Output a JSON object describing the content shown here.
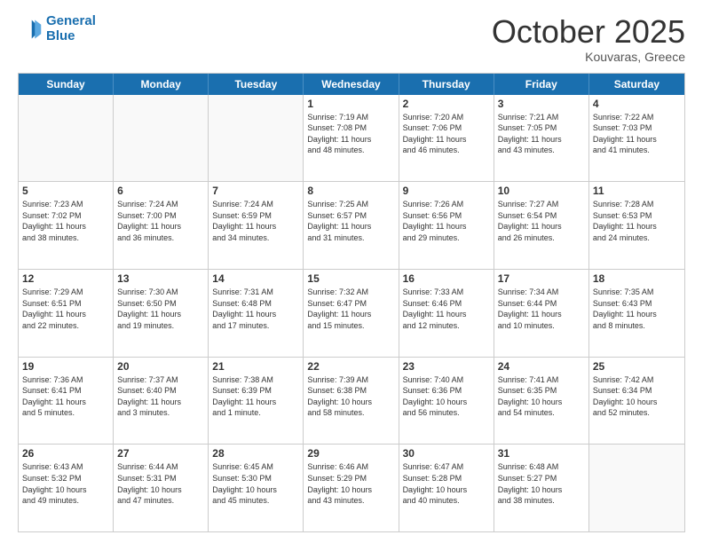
{
  "header": {
    "logo_line1": "General",
    "logo_line2": "Blue",
    "month_title": "October 2025",
    "location": "Kouvaras, Greece"
  },
  "days_of_week": [
    "Sunday",
    "Monday",
    "Tuesday",
    "Wednesday",
    "Thursday",
    "Friday",
    "Saturday"
  ],
  "weeks": [
    [
      {
        "day": "",
        "empty": true
      },
      {
        "day": "",
        "empty": true
      },
      {
        "day": "",
        "empty": true
      },
      {
        "day": "1",
        "line1": "Sunrise: 7:19 AM",
        "line2": "Sunset: 7:08 PM",
        "line3": "Daylight: 11 hours",
        "line4": "and 48 minutes."
      },
      {
        "day": "2",
        "line1": "Sunrise: 7:20 AM",
        "line2": "Sunset: 7:06 PM",
        "line3": "Daylight: 11 hours",
        "line4": "and 46 minutes."
      },
      {
        "day": "3",
        "line1": "Sunrise: 7:21 AM",
        "line2": "Sunset: 7:05 PM",
        "line3": "Daylight: 11 hours",
        "line4": "and 43 minutes."
      },
      {
        "day": "4",
        "line1": "Sunrise: 7:22 AM",
        "line2": "Sunset: 7:03 PM",
        "line3": "Daylight: 11 hours",
        "line4": "and 41 minutes."
      }
    ],
    [
      {
        "day": "5",
        "line1": "Sunrise: 7:23 AM",
        "line2": "Sunset: 7:02 PM",
        "line3": "Daylight: 11 hours",
        "line4": "and 38 minutes."
      },
      {
        "day": "6",
        "line1": "Sunrise: 7:24 AM",
        "line2": "Sunset: 7:00 PM",
        "line3": "Daylight: 11 hours",
        "line4": "and 36 minutes."
      },
      {
        "day": "7",
        "line1": "Sunrise: 7:24 AM",
        "line2": "Sunset: 6:59 PM",
        "line3": "Daylight: 11 hours",
        "line4": "and 34 minutes."
      },
      {
        "day": "8",
        "line1": "Sunrise: 7:25 AM",
        "line2": "Sunset: 6:57 PM",
        "line3": "Daylight: 11 hours",
        "line4": "and 31 minutes."
      },
      {
        "day": "9",
        "line1": "Sunrise: 7:26 AM",
        "line2": "Sunset: 6:56 PM",
        "line3": "Daylight: 11 hours",
        "line4": "and 29 minutes."
      },
      {
        "day": "10",
        "line1": "Sunrise: 7:27 AM",
        "line2": "Sunset: 6:54 PM",
        "line3": "Daylight: 11 hours",
        "line4": "and 26 minutes."
      },
      {
        "day": "11",
        "line1": "Sunrise: 7:28 AM",
        "line2": "Sunset: 6:53 PM",
        "line3": "Daylight: 11 hours",
        "line4": "and 24 minutes."
      }
    ],
    [
      {
        "day": "12",
        "line1": "Sunrise: 7:29 AM",
        "line2": "Sunset: 6:51 PM",
        "line3": "Daylight: 11 hours",
        "line4": "and 22 minutes."
      },
      {
        "day": "13",
        "line1": "Sunrise: 7:30 AM",
        "line2": "Sunset: 6:50 PM",
        "line3": "Daylight: 11 hours",
        "line4": "and 19 minutes."
      },
      {
        "day": "14",
        "line1": "Sunrise: 7:31 AM",
        "line2": "Sunset: 6:48 PM",
        "line3": "Daylight: 11 hours",
        "line4": "and 17 minutes."
      },
      {
        "day": "15",
        "line1": "Sunrise: 7:32 AM",
        "line2": "Sunset: 6:47 PM",
        "line3": "Daylight: 11 hours",
        "line4": "and 15 minutes."
      },
      {
        "day": "16",
        "line1": "Sunrise: 7:33 AM",
        "line2": "Sunset: 6:46 PM",
        "line3": "Daylight: 11 hours",
        "line4": "and 12 minutes."
      },
      {
        "day": "17",
        "line1": "Sunrise: 7:34 AM",
        "line2": "Sunset: 6:44 PM",
        "line3": "Daylight: 11 hours",
        "line4": "and 10 minutes."
      },
      {
        "day": "18",
        "line1": "Sunrise: 7:35 AM",
        "line2": "Sunset: 6:43 PM",
        "line3": "Daylight: 11 hours",
        "line4": "and 8 minutes."
      }
    ],
    [
      {
        "day": "19",
        "line1": "Sunrise: 7:36 AM",
        "line2": "Sunset: 6:41 PM",
        "line3": "Daylight: 11 hours",
        "line4": "and 5 minutes."
      },
      {
        "day": "20",
        "line1": "Sunrise: 7:37 AM",
        "line2": "Sunset: 6:40 PM",
        "line3": "Daylight: 11 hours",
        "line4": "and 3 minutes."
      },
      {
        "day": "21",
        "line1": "Sunrise: 7:38 AM",
        "line2": "Sunset: 6:39 PM",
        "line3": "Daylight: 11 hours",
        "line4": "and 1 minute."
      },
      {
        "day": "22",
        "line1": "Sunrise: 7:39 AM",
        "line2": "Sunset: 6:38 PM",
        "line3": "Daylight: 10 hours",
        "line4": "and 58 minutes."
      },
      {
        "day": "23",
        "line1": "Sunrise: 7:40 AM",
        "line2": "Sunset: 6:36 PM",
        "line3": "Daylight: 10 hours",
        "line4": "and 56 minutes."
      },
      {
        "day": "24",
        "line1": "Sunrise: 7:41 AM",
        "line2": "Sunset: 6:35 PM",
        "line3": "Daylight: 10 hours",
        "line4": "and 54 minutes."
      },
      {
        "day": "25",
        "line1": "Sunrise: 7:42 AM",
        "line2": "Sunset: 6:34 PM",
        "line3": "Daylight: 10 hours",
        "line4": "and 52 minutes."
      }
    ],
    [
      {
        "day": "26",
        "line1": "Sunrise: 6:43 AM",
        "line2": "Sunset: 5:32 PM",
        "line3": "Daylight: 10 hours",
        "line4": "and 49 minutes."
      },
      {
        "day": "27",
        "line1": "Sunrise: 6:44 AM",
        "line2": "Sunset: 5:31 PM",
        "line3": "Daylight: 10 hours",
        "line4": "and 47 minutes."
      },
      {
        "day": "28",
        "line1": "Sunrise: 6:45 AM",
        "line2": "Sunset: 5:30 PM",
        "line3": "Daylight: 10 hours",
        "line4": "and 45 minutes."
      },
      {
        "day": "29",
        "line1": "Sunrise: 6:46 AM",
        "line2": "Sunset: 5:29 PM",
        "line3": "Daylight: 10 hours",
        "line4": "and 43 minutes."
      },
      {
        "day": "30",
        "line1": "Sunrise: 6:47 AM",
        "line2": "Sunset: 5:28 PM",
        "line3": "Daylight: 10 hours",
        "line4": "and 40 minutes."
      },
      {
        "day": "31",
        "line1": "Sunrise: 6:48 AM",
        "line2": "Sunset: 5:27 PM",
        "line3": "Daylight: 10 hours",
        "line4": "and 38 minutes."
      },
      {
        "day": "",
        "empty": true
      }
    ]
  ]
}
